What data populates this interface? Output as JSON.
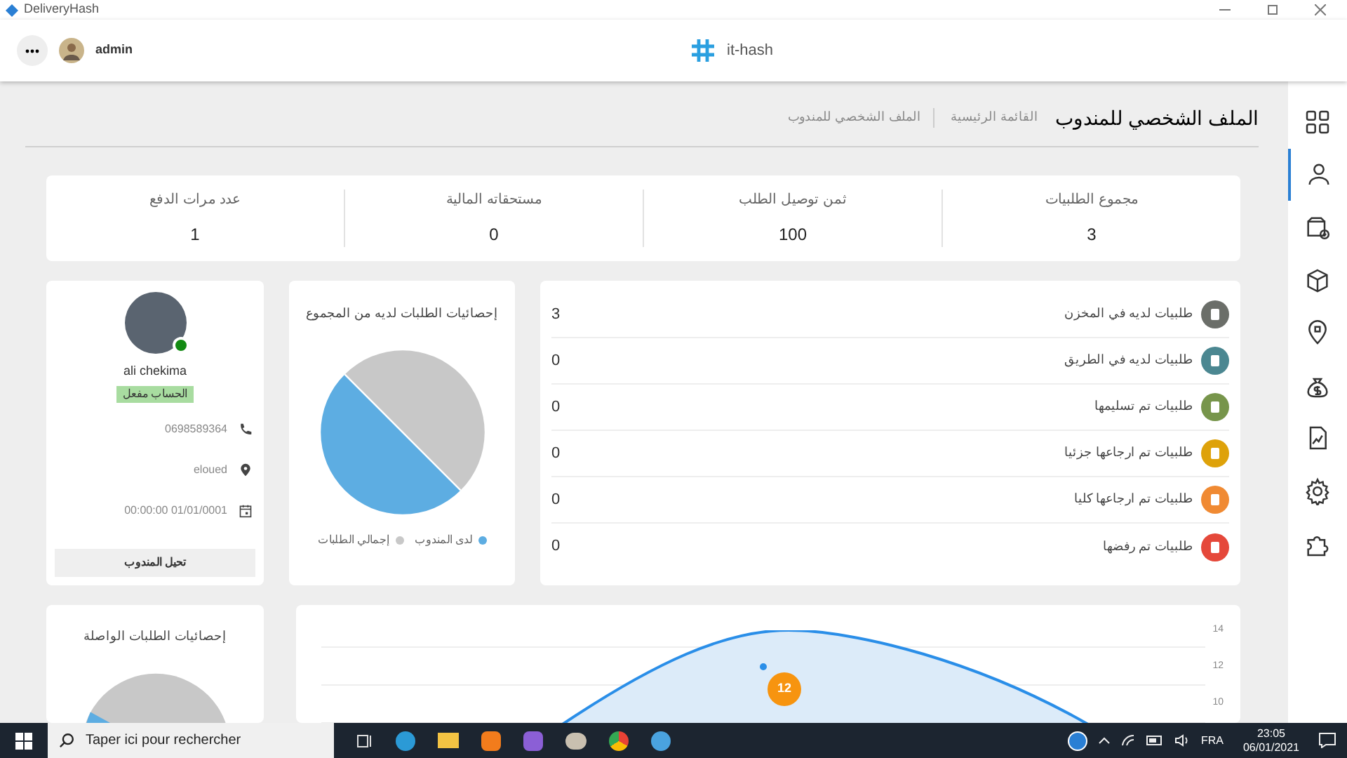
{
  "window": {
    "title": "DeliveryHash"
  },
  "header": {
    "user": "admin",
    "brand": "it-hash"
  },
  "sidebar": {
    "items": [
      {
        "selected": false
      },
      {
        "selected": true
      },
      {
        "selected": false
      },
      {
        "selected": false
      },
      {
        "selected": false
      },
      {
        "selected": false
      },
      {
        "selected": false
      },
      {
        "selected": false
      },
      {
        "selected": false
      }
    ]
  },
  "page": {
    "title": "الملف الشخصي للمندوب",
    "breadcrumbs": [
      "القائمة الرئيسية",
      "الملف الشخصي للمندوب"
    ]
  },
  "stats": [
    {
      "label": "مجموع الطلبيات",
      "value": "3"
    },
    {
      "label": "ثمن توصيل الطلب",
      "value": "100"
    },
    {
      "label": "مستحقاته المالية",
      "value": "0"
    },
    {
      "label": "عدد مرات الدفع",
      "value": "1"
    }
  ],
  "orders": [
    {
      "label": "طلبيات لديه في المخزن",
      "value": "3",
      "color": "#6b6e69"
    },
    {
      "label": "طلبيات لديه في الطريق",
      "value": "0",
      "color": "#4b8791"
    },
    {
      "label": "طلبيات تم تسليمها",
      "value": "0",
      "color": "#77954b"
    },
    {
      "label": "طلبيات تم ارجاعها جزئيا",
      "value": "0",
      "color": "#dea20a"
    },
    {
      "label": "طلبيات تم ارجاعها كليا",
      "value": "0",
      "color": "#f08a33"
    },
    {
      "label": "طلبيات تم رفضها",
      "value": "0",
      "color": "#e5483a"
    }
  ],
  "pie_card": {
    "title": "إحصائيات الطلبات لديه من المجموع",
    "legend": [
      {
        "label": "لدى المندوب",
        "color": "#5dade2"
      },
      {
        "label": "إجمالي الطلبات",
        "color": "#c8c8c8"
      }
    ]
  },
  "profile": {
    "name": "ali chekima",
    "online": true,
    "status": "الحساب مفعل",
    "phone": "0698589364",
    "city": "eloued",
    "date": "00:00:00 01/01/0001",
    "button": "تحيل المندوب"
  },
  "delivered_card": {
    "title": "إحصائيات الطلبات الواصلة"
  },
  "area_chart": {
    "yaxis_labels": [
      "14",
      "12",
      "10"
    ],
    "tooltip": "12"
  },
  "taskbar": {
    "search": "Taper ici pour rechercher",
    "language": "FRA",
    "time": "23:05",
    "date": "06/01/2021"
  }
}
